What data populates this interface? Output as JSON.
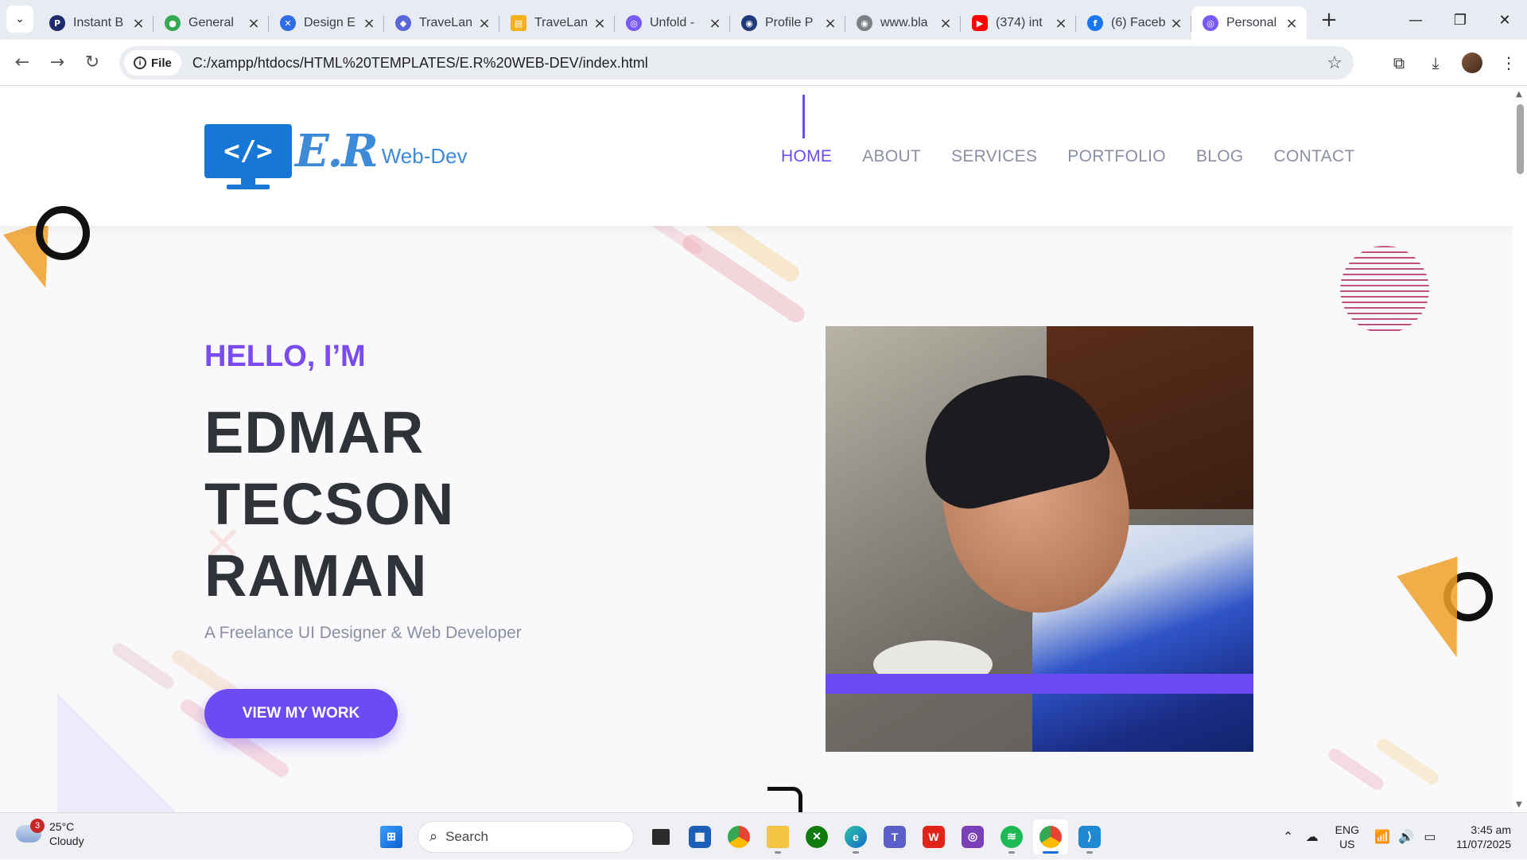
{
  "browser": {
    "tabs": [
      {
        "title": "Instant B",
        "favicon": "P",
        "color": "#1d2a6b"
      },
      {
        "title": "General",
        "favicon": "maps-pin",
        "color": "#34a853"
      },
      {
        "title": "Design E",
        "favicon": "figma-like",
        "color": "#2f6ce5"
      },
      {
        "title": "TraveLan",
        "favicon": "cube",
        "color": "#5a67d8"
      },
      {
        "title": "TraveLan",
        "favicon": "doc",
        "color": "#f2b01e"
      },
      {
        "title": "Unfold -",
        "favicon": "spiral",
        "color": "#7a5af5"
      },
      {
        "title": "Profile P",
        "favicon": "globe",
        "color": "#1e3a7a"
      },
      {
        "title": "www.bla",
        "favicon": "globe",
        "color": "#7b7f86"
      },
      {
        "title": "(374) int",
        "favicon": "youtube",
        "color": "#ff0000"
      },
      {
        "title": "(6) Faceb",
        "favicon": "f",
        "color": "#1877f2"
      },
      {
        "title": "Personal",
        "favicon": "spiral",
        "color": "#7a5af5",
        "active": true
      }
    ],
    "address": {
      "chip": "File",
      "url": "C:/xampp/htdocs/HTML%20TEMPLATES/E.R%20WEB-DEV/index.html"
    }
  },
  "site": {
    "logo": {
      "code": "</>",
      "er": "E.R",
      "sub": "Web-Dev"
    },
    "nav": [
      "HOME",
      "ABOUT",
      "SERVICES",
      "PORTFOLIO",
      "BLOG",
      "CONTACT"
    ],
    "active_nav": "HOME",
    "hero": {
      "greeting": "HELLO, I’M",
      "name_lines": [
        "EDMAR",
        "TECSON",
        "RAMAN"
      ],
      "tagline": "A Freelance UI Designer & Web Developer",
      "cta": "VIEW MY WORK"
    },
    "accent": "#6c4cf2"
  },
  "taskbar": {
    "weather": {
      "temp": "25°C",
      "condition": "Cloudy",
      "badge": "3"
    },
    "search_label": "Search",
    "apps": [
      "task-view",
      "store",
      "chrome",
      "file-explorer",
      "xbox",
      "edge",
      "teams",
      "wps",
      "aperture",
      "spotify",
      "chrome-profile",
      "vscode"
    ],
    "tray": {
      "lang1": "ENG",
      "lang2": "US",
      "time": "3:45 am",
      "date": "11/07/2025"
    }
  }
}
